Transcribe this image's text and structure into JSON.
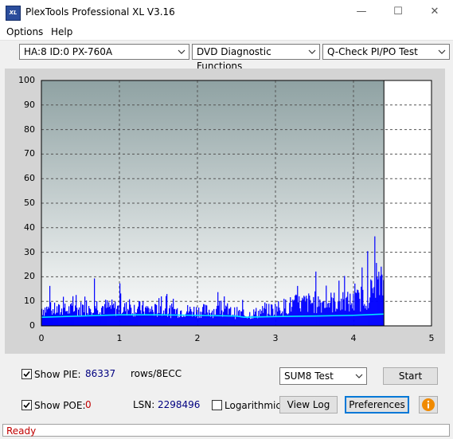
{
  "window": {
    "app_icon_text": "XL",
    "title": "PlexTools Professional XL V3.16",
    "minimize_glyph": "—",
    "maximize_glyph": "☐",
    "close_glyph": "✕"
  },
  "menu": {
    "options": "Options",
    "help": "Help"
  },
  "toolbar": {
    "drive": "HA:8 ID:0  PX-760A",
    "function": "DVD Diagnostic Functions",
    "test": "Q-Check PI/PO Test"
  },
  "chart_data": {
    "type": "bar",
    "title": "",
    "xlabel": "",
    "ylabel": "",
    "xlim": [
      0,
      5
    ],
    "ylim": [
      0,
      100
    ],
    "x_ticks": [
      "0",
      "1",
      "2",
      "3",
      "4",
      "5"
    ],
    "y_ticks": [
      "100",
      "90",
      "80",
      "70",
      "60",
      "50",
      "40",
      "30",
      "20",
      "10",
      "0"
    ],
    "grid": true,
    "scan_end_x": 4.39,
    "series": [
      {
        "color": "#0000ff",
        "x": [
          0.0,
          0.25,
          0.5,
          0.65,
          0.75,
          1.0,
          1.25,
          1.5,
          1.75,
          2.0,
          2.25,
          2.5,
          2.6,
          2.75,
          3.0,
          3.25,
          3.5,
          3.75,
          4.0,
          4.1,
          4.2,
          4.3,
          4.39
        ],
        "values": [
          8,
          7,
          8,
          10,
          9,
          8,
          8,
          7,
          7,
          7,
          7,
          6,
          5,
          6,
          8,
          10,
          11,
          11,
          11,
          13,
          15,
          18,
          20
        ]
      },
      {
        "color": "#00e5ff",
        "x": [
          0.0,
          0.5,
          1.0,
          1.5,
          2.0,
          2.5,
          2.6,
          3.0,
          3.5,
          4.0,
          4.39
        ],
        "values": [
          3.5,
          4,
          4.5,
          4.5,
          4.3,
          4,
          3.5,
          3.8,
          4,
          4.3,
          4.8
        ]
      }
    ]
  },
  "controls": {
    "show_pie_label": "Show PIE:",
    "show_pie_checked": true,
    "pie_value": "86337",
    "rows_label": "rows/8ECC",
    "show_poe_label": "Show POE:",
    "show_poe_checked": true,
    "poe_value": "0",
    "lsn_label": "LSN:",
    "lsn_value": "2298496",
    "logarithmic_label": "Logarithmic",
    "logarithmic_checked": false,
    "sum_select": "SUM8 Test",
    "start_button": "Start",
    "view_log_button": "View Log",
    "preferences_button": "Preferences"
  },
  "status": {
    "text": "Ready"
  },
  "colors": {
    "plot_bg_top": "#90a4a4",
    "plot_bg_bottom": "#ffffff",
    "pie_bars": "#0000ff",
    "poe_line": "#00e5ff",
    "status_text": "#c00000"
  }
}
